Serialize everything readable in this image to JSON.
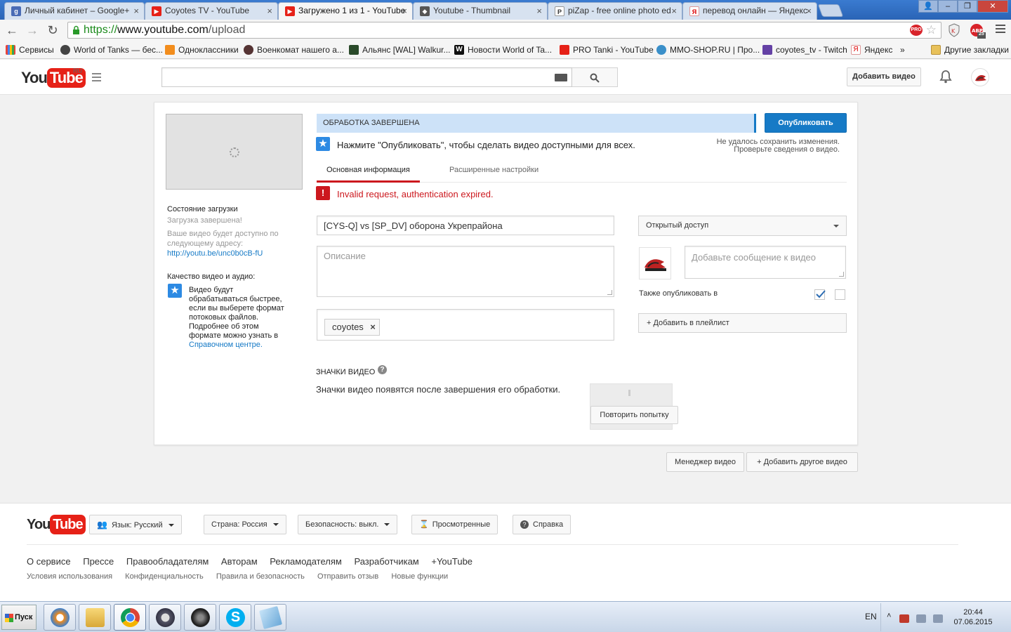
{
  "browser": {
    "tabs": [
      {
        "title": "Личный кабинет – Google+",
        "active": false,
        "favicon_color": "#4a6cb5"
      },
      {
        "title": "Coyotes TV - YouTube",
        "active": false,
        "favicon_color": "#e62117"
      },
      {
        "title": "Загружено 1 из 1 - YouTube",
        "active": true,
        "favicon_color": "#e62117"
      },
      {
        "title": "Youtube - Thumbnail",
        "active": false,
        "favicon_color": "#555555"
      },
      {
        "title": "piZap - free online photo ed",
        "active": false,
        "favicon_color": "#ffffff"
      },
      {
        "title": "перевод онлайн — Яндекс",
        "active": false,
        "favicon_color": "#ffffff"
      }
    ],
    "url_scheme": "https://",
    "url_host": "www.youtube.com",
    "url_path": "/upload",
    "bookmarks": [
      {
        "label": "Сервисы",
        "color": "#e8443a"
      },
      {
        "label": "World of Tanks — бес...",
        "color": "#444444"
      },
      {
        "label": "Одноклассники",
        "color": "#f28d1d"
      },
      {
        "label": "Военкомат нашего а...",
        "color": "#553333"
      },
      {
        "label": "Альянс [WAL] Walkur...",
        "color": "#2a4a2a"
      },
      {
        "label": "Новости World of Ta...",
        "color": "#111111"
      },
      {
        "label": "PRO Tanki - YouTube",
        "color": "#e62117"
      },
      {
        "label": "MMO-SHOP.RU | Про...",
        "color": "#3a8fc9"
      },
      {
        "label": "coyotes_tv - Twitch",
        "color": "#6441a5"
      },
      {
        "label": "Яндекс",
        "color": "#ffffff"
      }
    ],
    "bookmarks_more": "»",
    "other_bookmarks": "Другие закладки",
    "ext_abp_count": "25"
  },
  "yt_header": {
    "logo_you": "You",
    "logo_tube": "Tube",
    "region": "RU",
    "upload_label": "Добавить видео"
  },
  "upload": {
    "status_title": "ОБРАБОТКА ЗАВЕРШЕНА",
    "publish_label": "Опубликовать",
    "hint": "Нажмите \"Опубликовать\", чтобы сделать видео доступными для всех.",
    "save_error_line1": "Не удалось сохранить изменения.",
    "save_error_line2": "Проверьте сведения о видео.",
    "tab_basic": "Основная информация",
    "tab_advanced": "Расширенные настройки",
    "error_message": "Invalid request, authentication expired.",
    "title_value": "[CYS-Q] vs [SP_DV] оборона Укрепрайона",
    "description_placeholder": "Описание",
    "tag": "coyotes",
    "privacy_value": "Открытый доступ",
    "message_placeholder": "Добавьте сообщение к видео",
    "also_publish": "Также опубликовать в",
    "add_playlist": "+ Добавить в плейлист",
    "thumbs_title": "ЗНАЧКИ ВИДЕО",
    "thumbs_note": "Значки видео появятся после завершения его обработки.",
    "retry_label": "Повторить попытку"
  },
  "sidebar": {
    "upload_state_label": "Состояние загрузки",
    "upload_state_value": "Загрузка завершена!",
    "available_text": "Ваше видео будет доступно по следующему адресу:",
    "video_url": "http://youtu.be/unc0b0cB-fU",
    "quality_label": "Качество видео и аудио:",
    "quality_text": "Видео будут обрабатываться быстрее, если вы выберете формат потоковых файлов. Подробнее об этом формате можно узнать в",
    "help_center_link": "Справочном центре."
  },
  "actions": {
    "video_manager": "Менеджер видео",
    "add_another": "+ Добавить другое видео"
  },
  "footer": {
    "language": "Язык: Русский",
    "country": "Страна: Россия",
    "safety": "Безопасность: выкл.",
    "history": "Просмотренные",
    "help": "Справка",
    "links_primary": [
      "О сервисе",
      "Прессе",
      "Правообладателям",
      "Авторам",
      "Рекламодателям",
      "Разработчикам",
      "+YouTube"
    ],
    "links_secondary": [
      "Условия использования",
      "Конфиденциальность",
      "Правила и безопасность",
      "Отправить отзыв",
      "Новые функции"
    ]
  },
  "taskbar": {
    "start_label": "Пуск",
    "lang": "EN",
    "time": "20:44",
    "date": "07.06.2015"
  }
}
